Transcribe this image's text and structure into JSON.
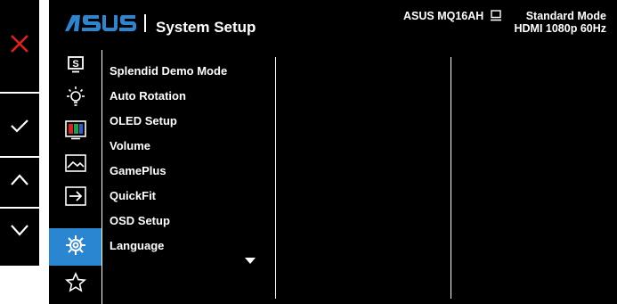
{
  "controls": {
    "exit": "close-icon",
    "confirm": "checkmark-icon",
    "up": "chevron-up-icon",
    "down": "chevron-down-icon",
    "exit_color": "#e02020"
  },
  "header": {
    "logo_text": "/ISUS",
    "title": "System Setup",
    "model": "ASUS MQ16AH",
    "mode": "Standard Mode",
    "signal": "HDMI  1080p 60Hz"
  },
  "sidebar": {
    "items": [
      {
        "icon": "splendid-icon"
      },
      {
        "icon": "lightbulb-icon"
      },
      {
        "icon": "color-bars-icon"
      },
      {
        "icon": "image-icon"
      },
      {
        "icon": "input-select-icon"
      },
      {
        "icon": "gear-icon",
        "selected": true
      },
      {
        "icon": "star-icon"
      }
    ],
    "selected_color": "#2b86d1"
  },
  "menu": {
    "items": [
      "Splendid Demo Mode",
      "Auto Rotation",
      "OLED Setup",
      "Volume",
      "GamePlus",
      "QuickFit",
      "OSD Setup",
      "Language"
    ],
    "more": "chevron-down-icon"
  }
}
